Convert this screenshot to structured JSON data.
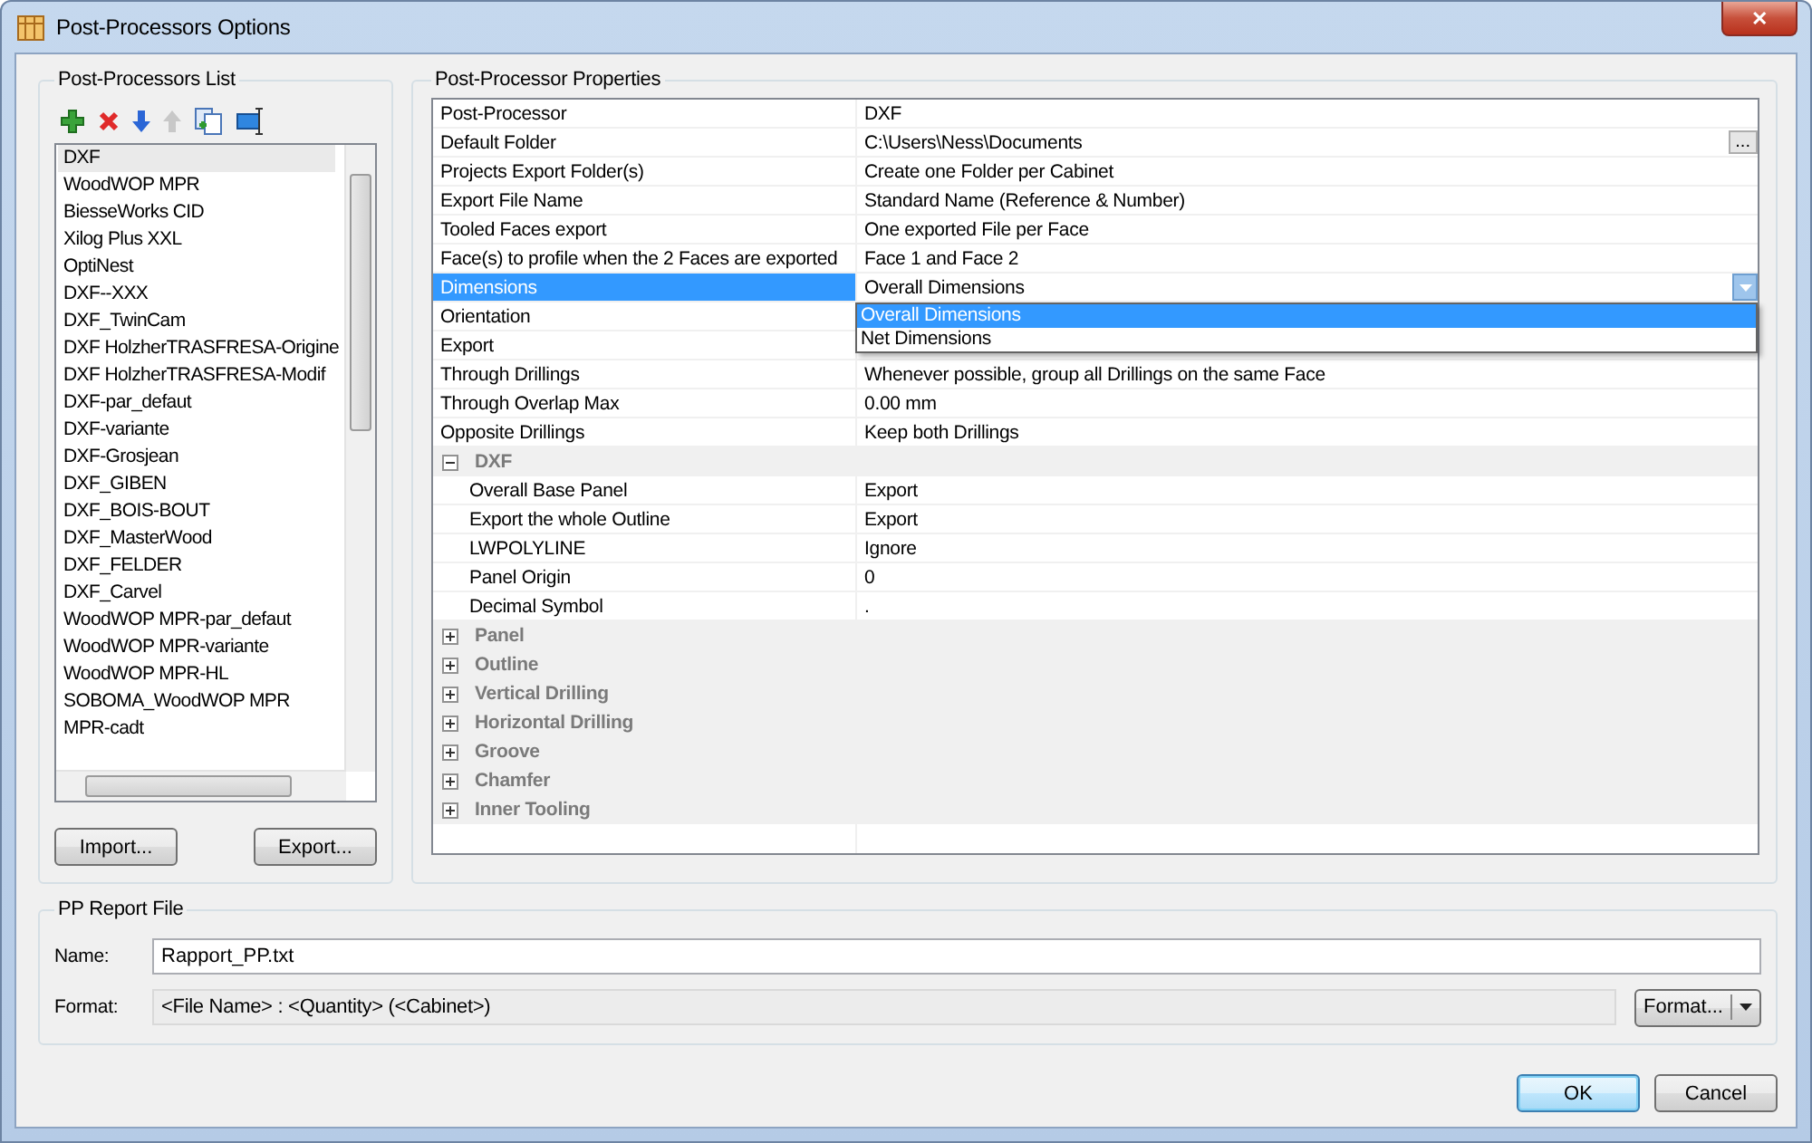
{
  "window": {
    "title": "Post-Processors Options",
    "close": "✕"
  },
  "list_panel": {
    "title": "Post-Processors List",
    "items": [
      {
        "label": "DXF",
        "selected": true
      },
      {
        "label": "WoodWOP MPR",
        "selected": false
      },
      {
        "label": "BiesseWorks CID",
        "selected": false
      },
      {
        "label": "Xilog Plus XXL",
        "selected": false
      },
      {
        "label": "OptiNest",
        "selected": false
      },
      {
        "label": "DXF--XXX",
        "selected": false
      },
      {
        "label": "DXF_TwinCam",
        "selected": false
      },
      {
        "label": "DXF HolzherTRASFRESA-Origine",
        "selected": false
      },
      {
        "label": "DXF HolzherTRASFRESA-Modif",
        "selected": false
      },
      {
        "label": "DXF-par_defaut",
        "selected": false
      },
      {
        "label": "DXF-variante",
        "selected": false
      },
      {
        "label": "DXF-Grosjean",
        "selected": false
      },
      {
        "label": "DXF_GIBEN",
        "selected": false
      },
      {
        "label": "DXF_BOIS-BOUT",
        "selected": false
      },
      {
        "label": "DXF_MasterWood",
        "selected": false
      },
      {
        "label": "DXF_FELDER",
        "selected": false
      },
      {
        "label": "DXF_Carvel",
        "selected": false
      },
      {
        "label": "WoodWOP MPR-par_defaut",
        "selected": false
      },
      {
        "label": "WoodWOP MPR-variante",
        "selected": false
      },
      {
        "label": "WoodWOP MPR-HL",
        "selected": false
      },
      {
        "label": "SOBOMA_WoodWOP MPR",
        "selected": false
      },
      {
        "label": "MPR-cadt",
        "selected": false
      }
    ],
    "buttons": [
      "Import...",
      "Export..."
    ]
  },
  "properties": {
    "title": "Post-Processor Properties",
    "rows": [
      {
        "kind": "prop",
        "name": "Post-Processor",
        "value": "DXF",
        "selected": false
      },
      {
        "kind": "prop",
        "name": "Default Folder",
        "value": "C:\\Users\\Ness\\Documents",
        "selected": false,
        "button": "..."
      },
      {
        "kind": "prop",
        "name": "Projects Export Folder(s)",
        "value": "Create one Folder per Cabinet",
        "selected": false
      },
      {
        "kind": "prop",
        "name": "Export File Name",
        "value": "Standard Name (Reference & Number)",
        "selected": false
      },
      {
        "kind": "prop",
        "name": "Tooled Faces export",
        "value": "One exported File per Face",
        "selected": false
      },
      {
        "kind": "prop",
        "name": "Face(s) to profile when the 2 Faces are exported",
        "value": "Face 1 and Face 2",
        "selected": false
      },
      {
        "kind": "combo",
        "name": "Dimensions",
        "value": "Overall Dimensions",
        "selected": true,
        "options": [
          {
            "label": "Overall Dimensions",
            "selected": true
          },
          {
            "label": "Net Dimensions",
            "selected": false
          }
        ]
      },
      {
        "kind": "prop",
        "name": "Orientation",
        "selected": false
      },
      {
        "kind": "prop",
        "name": "Export",
        "selected": false
      },
      {
        "kind": "prop",
        "name": "Through Drillings",
        "value": "Whenever possible, group all Drillings on the same Face",
        "selected": false
      },
      {
        "kind": "prop",
        "name": "Through Overlap Max",
        "value": "0.00 mm",
        "selected": false
      },
      {
        "kind": "prop",
        "name": "Opposite Drillings",
        "value": "Keep both Drillings",
        "selected": false
      },
      {
        "kind": "group",
        "name": "DXF",
        "expanded": true,
        "children": [
          {
            "name": "Overall Base Panel",
            "value": "Export"
          },
          {
            "name": "Export the whole Outline",
            "value": "Export"
          },
          {
            "name": "LWPOLYLINE",
            "value": "Ignore"
          },
          {
            "name": "Panel Origin",
            "value": "0"
          },
          {
            "name": "Decimal Symbol",
            "value": "."
          }
        ]
      },
      {
        "kind": "group",
        "name": "Panel",
        "expanded": false
      },
      {
        "kind": "group",
        "name": "Outline",
        "expanded": false
      },
      {
        "kind": "group",
        "name": "Vertical Drilling",
        "expanded": false
      },
      {
        "kind": "group",
        "name": "Horizontal Drilling",
        "expanded": false
      },
      {
        "kind": "group",
        "name": "Groove",
        "expanded": false
      },
      {
        "kind": "group",
        "name": "Chamfer",
        "expanded": false
      },
      {
        "kind": "group",
        "name": "Inner Tooling",
        "expanded": false
      }
    ]
  },
  "report": {
    "title": "PP Report File",
    "name_label": "Name:",
    "name_value": "Rapport_PP.txt",
    "format_label": "Format:",
    "format_value": "<File Name> : <Quantity> (<Cabinet>)",
    "format_button": "Format..."
  },
  "buttons": [
    {
      "label": "OK",
      "default": true
    },
    {
      "label": "Cancel",
      "default": false
    }
  ]
}
